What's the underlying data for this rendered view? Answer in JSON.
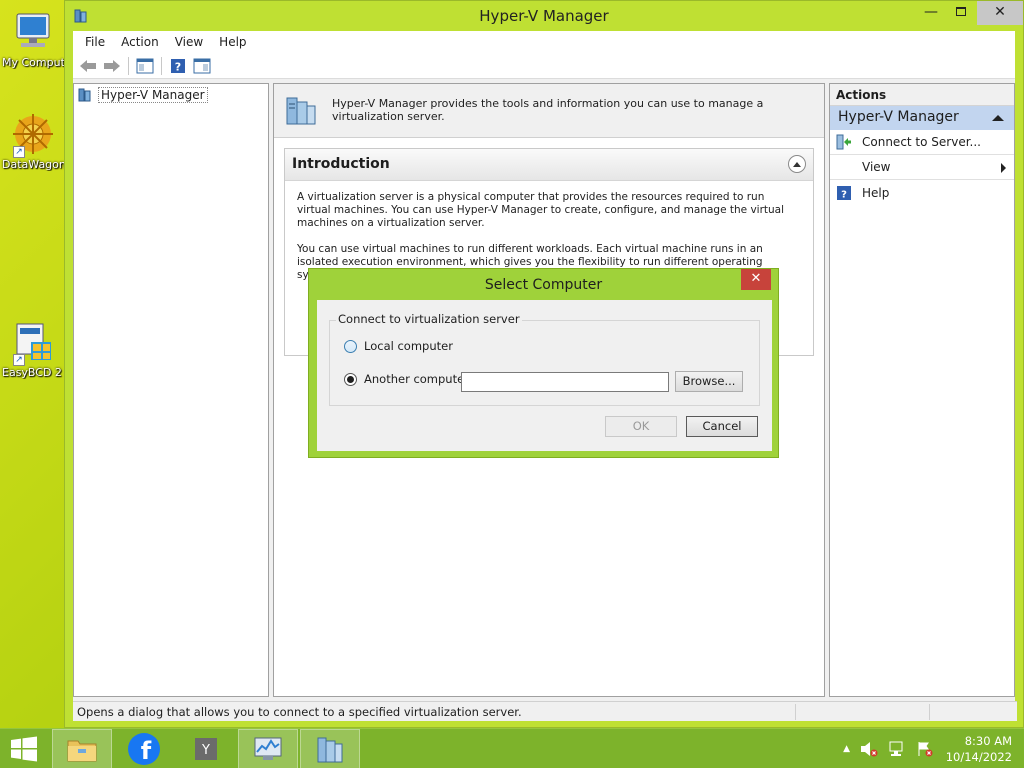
{
  "desktop": {
    "icons": [
      {
        "label": "My Computer"
      },
      {
        "label": "DataWagon"
      },
      {
        "label": "EasyBCD 2"
      }
    ]
  },
  "window": {
    "title": "Hyper-V Manager",
    "menu": [
      "File",
      "Action",
      "View",
      "Help"
    ],
    "tree": {
      "root": "Hyper-V Manager"
    },
    "center": {
      "header_desc": "Hyper-V Manager provides the tools and information you can use to manage a virtualization server.",
      "intro": {
        "title": "Introduction",
        "para1": "A virtualization server is a physical computer that provides the resources required to run virtual machines. You can use Hyper-V Manager to create, configure, and manage the virtual machines on a virtualization server.",
        "para2": "You can use virtual machines to run different workloads. Each virtual machine runs in an isolated execution environment, which gives you the flexibility to run different operating systems and applications on one"
      }
    },
    "actions": {
      "title": "Actions",
      "group": "Hyper-V Manager",
      "items": [
        {
          "label": "Connect to Server...",
          "icon": "connect-server-icon"
        },
        {
          "label": "View",
          "icon": "none"
        },
        {
          "label": "Help",
          "icon": "help-icon"
        }
      ]
    },
    "status": "Opens a dialog that allows you to connect to a specified virtualization server."
  },
  "dialog": {
    "title": "Select Computer",
    "group_label": "Connect to virtualization server",
    "option_local": "Local computer",
    "option_another": "Another computer:",
    "selected": "another",
    "computer_value": "",
    "browse_label": "Browse...",
    "ok_label": "OK",
    "cancel_label": "Cancel"
  },
  "taskbar": {
    "apps": [
      "start-icon",
      "file-explorer-icon",
      "facebook-icon",
      "yahoo-icon",
      "task-manager-icon",
      "hyper-v-icon"
    ],
    "time": "8:30 AM",
    "date": "10/14/2022"
  },
  "colors": {
    "accent": "#bfe033",
    "dialog_frame": "#9fd23a",
    "close_red": "#c7433b",
    "actions_group_bg": "#c2d5ef",
    "taskbar": "#7db32b"
  }
}
